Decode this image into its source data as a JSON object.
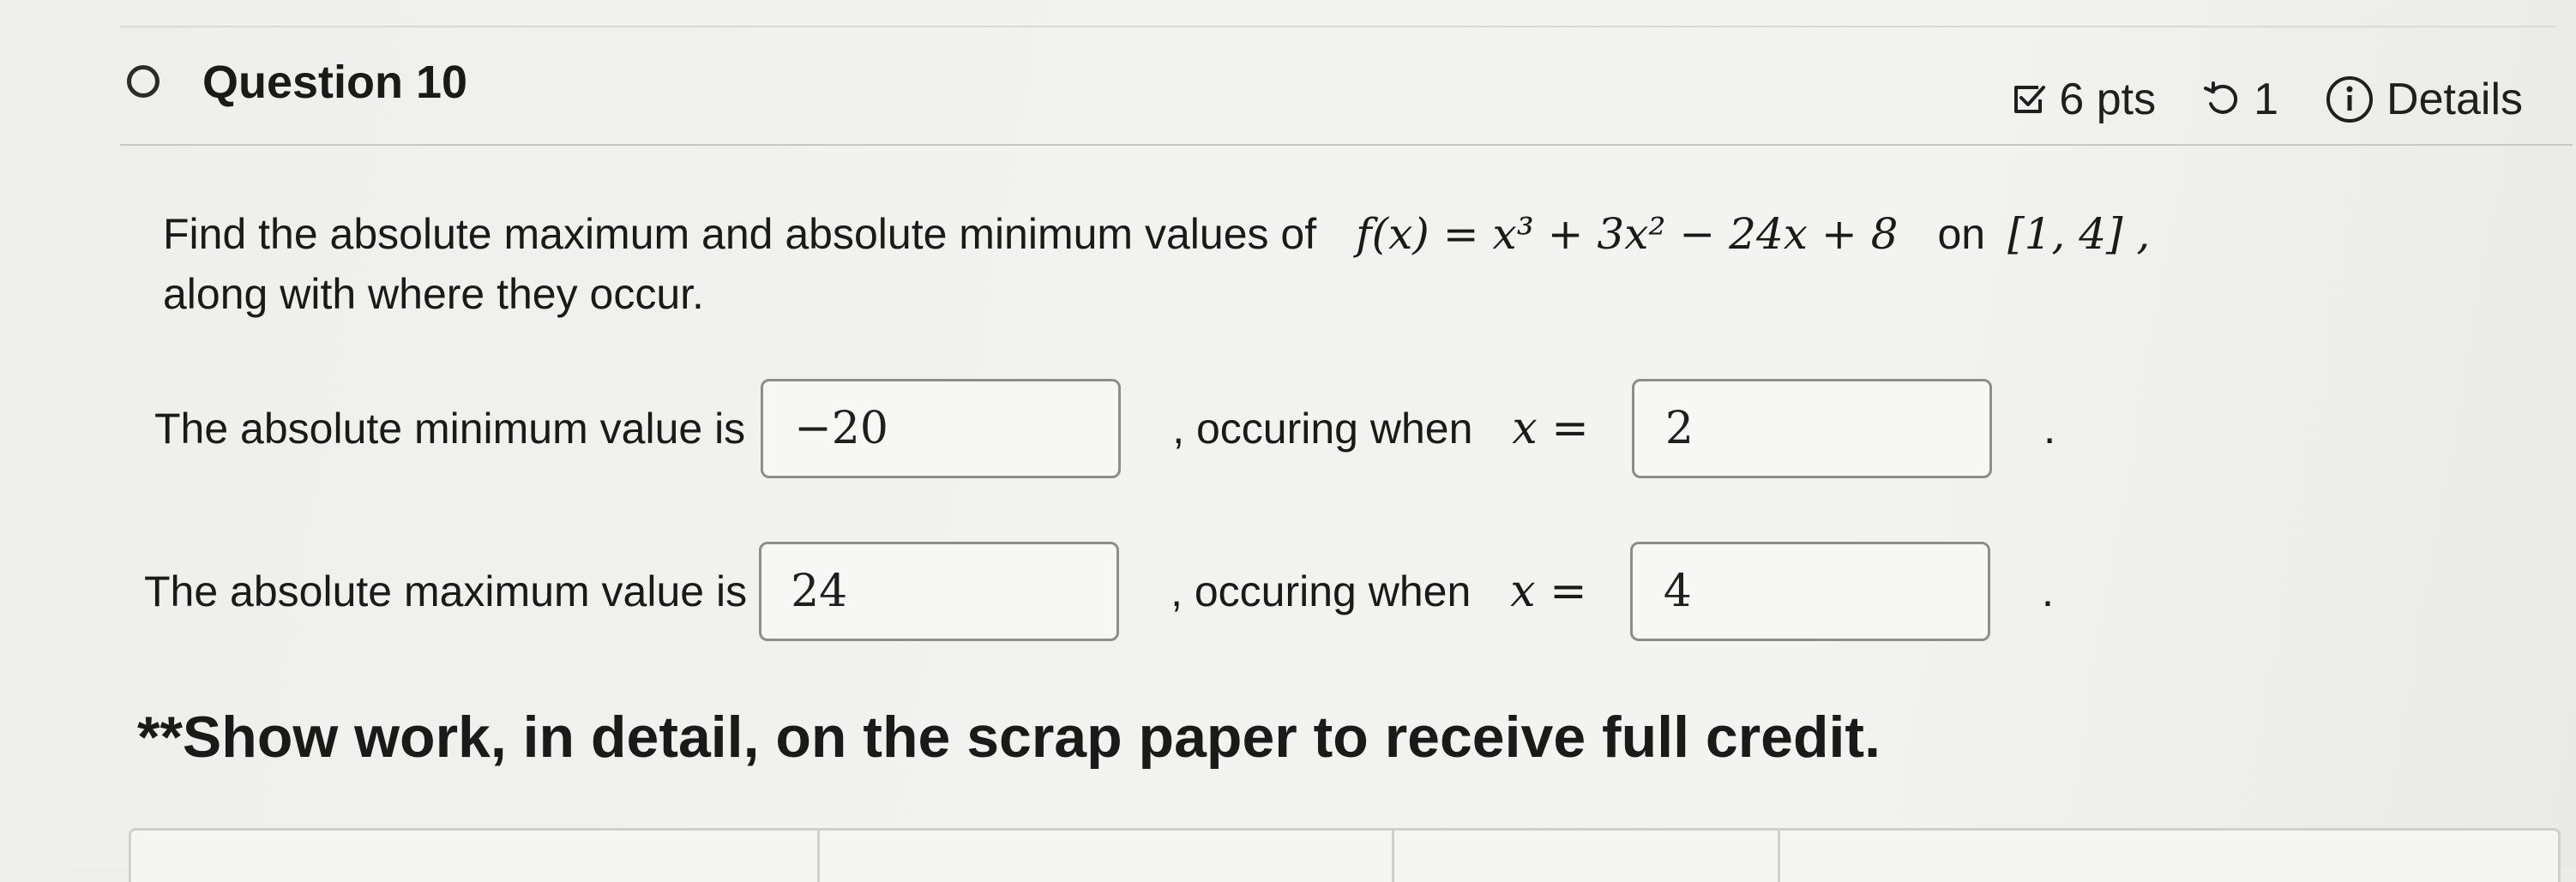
{
  "question": {
    "title": "Question 10",
    "points": "6 pts",
    "attempts": "1",
    "details_label": "Details"
  },
  "prompt": {
    "line1_text": "Find the absolute maximum and absolute minimum values of",
    "function_expr": "f(x) = x³ + 3x² − 24x + 8",
    "on_word": "on",
    "interval": "[1, 4] ,",
    "line2_text": "along with where they occur."
  },
  "minimum": {
    "label": "The absolute minimum value is",
    "value": "−20",
    "occurring_label": ", occuring when",
    "x_label": "x =",
    "x_value": "2",
    "trailing": "."
  },
  "maximum": {
    "label": "The absolute maximum value is",
    "value": "24",
    "occurring_label": ", occuring when",
    "x_label": "x =",
    "x_value": "4",
    "trailing": "."
  },
  "note": "**Show work, in detail, on the scrap paper to receive full credit.",
  "icons": {
    "status": "circle-outline-icon",
    "points": "checkbox-icon",
    "attempts": "retry-icon",
    "details": "info-icon"
  },
  "colors": {
    "text": "#1a1a1a",
    "box_border": "#8d8d8a",
    "background": "#f2f2f0"
  }
}
